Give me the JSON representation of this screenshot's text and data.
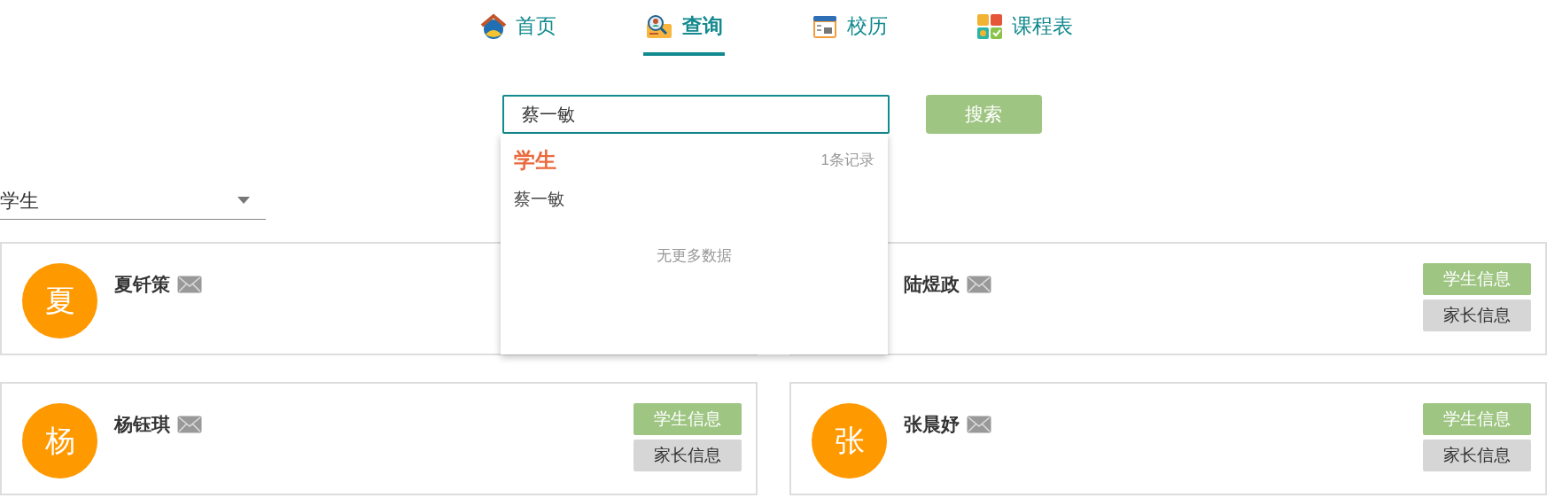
{
  "nav": {
    "tabs": [
      {
        "label": "首页",
        "selected": false
      },
      {
        "label": "查询",
        "selected": true
      },
      {
        "label": "校历",
        "selected": false
      },
      {
        "label": "课程表",
        "selected": false
      }
    ]
  },
  "search": {
    "value": "蔡一敏",
    "button": "搜索"
  },
  "suggestions": {
    "category": "学生",
    "count": "1条记录",
    "results": [
      "蔡一敏"
    ],
    "end_note": "无更多数据"
  },
  "filter": {
    "value": "学生"
  },
  "cards": [
    {
      "avatar": "夏",
      "name": "夏钎策"
    },
    {
      "name": "陆煜政",
      "buttons": [
        {
          "label": "学生信息",
          "kind": "primary"
        },
        {
          "label": "家长信息",
          "kind": "secondary"
        }
      ]
    },
    {
      "avatar": "杨",
      "name": "杨钰琪",
      "buttons": [
        {
          "label": "学生信息",
          "kind": "primary"
        },
        {
          "label": "家长信息",
          "kind": "secondary"
        }
      ]
    },
    {
      "avatar": "张",
      "name": "张晨妤",
      "buttons": [
        {
          "label": "学生信息",
          "kind": "primary"
        },
        {
          "label": "家长信息",
          "kind": "secondary"
        }
      ]
    }
  ]
}
